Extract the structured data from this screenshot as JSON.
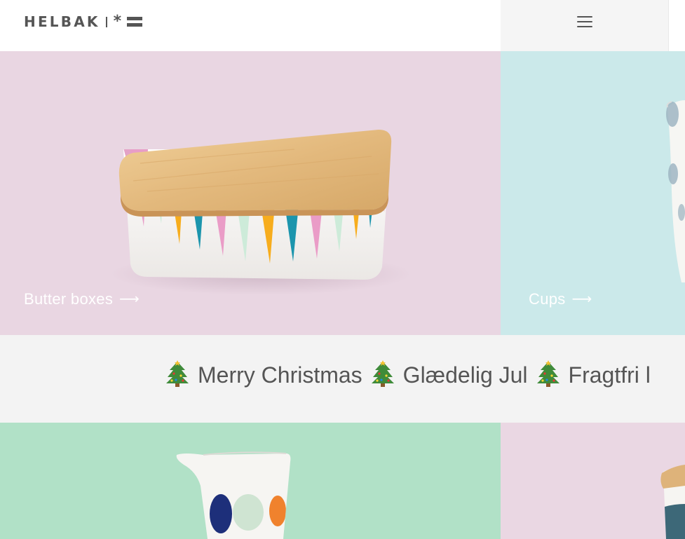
{
  "brand": {
    "logo_text": "HELBAK",
    "logo_symbol": "*"
  },
  "header": {
    "menu_icon": "hamburger-menu-icon"
  },
  "tiles": [
    {
      "label": "Butter boxes",
      "arrow": "⟶",
      "color": "#e9d6e2"
    },
    {
      "label": "Cups",
      "arrow": "⟶",
      "color": "#cbe9ea"
    }
  ],
  "lower_tiles": [
    {
      "color": "#b1e1c7"
    },
    {
      "color": "#ead7e3"
    }
  ],
  "banner": {
    "messages": [
      "Merry Christmas",
      "Glædelig Jul",
      "Fragtfri l"
    ],
    "icon": "christmas-tree-icon"
  }
}
